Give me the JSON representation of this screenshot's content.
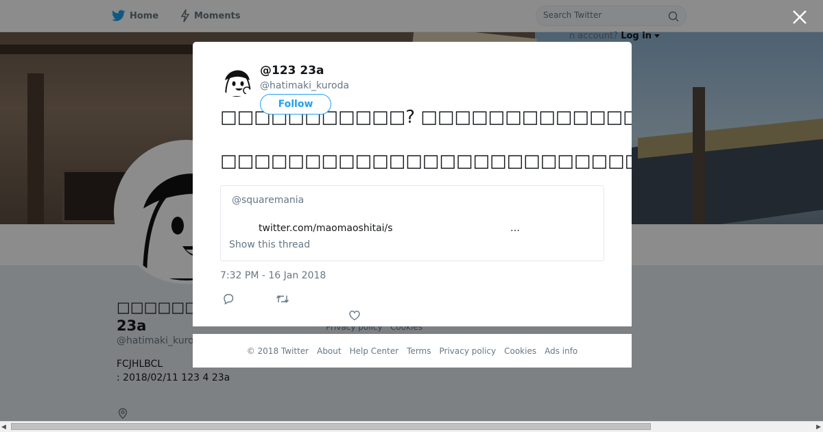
{
  "nav": {
    "home_label": "Home",
    "moments_label": "Moments",
    "search_placeholder": "Search Twitter",
    "login_prefix": "n account?",
    "login_label": "Log in"
  },
  "profile": {
    "name": "□□□□□□□@□ 23a",
    "handle": "@hatimaki_kuro",
    "bio": "FCJHLBCL\n      : 2018/02/11 123 4 23a",
    "footer_links": [
      "Privacy policy",
      "Cookies"
    ]
  },
  "modal": {
    "display_name": "@123 23a",
    "handle": "@hatimaki_kuroda",
    "follow_label": "Follow",
    "tweet_line1": "□□□□□□□□□□□? □□□□□□□□□□□□□□□□□□□□□□□□□□□□□□□□□□□□□□□□□",
    "tweet_line2": "□□□□□□□□□□□□□□□□□□□□□□□□□□□□□□□□□□□□□□□□□□□□□□□□□□□□□□□",
    "quote_handle": "@squaremania",
    "quote_link": "twitter.com/maomaoshitai/s",
    "quote_ellipsis": "…",
    "show_thread": "Show this thread",
    "timestamp": "7:32 PM - 16 Jan 2018"
  },
  "footer": {
    "copyright": "© 2018 Twitter",
    "about": "About",
    "help": "Help Center",
    "terms": "Terms",
    "privacy": "Privacy policy",
    "cookies": "Cookies",
    "ads": "Ads info"
  },
  "colors": {
    "brand": "#1da1f2",
    "secondary_text": "#657786",
    "overlay": "rgba(0,0,0,0.45)"
  },
  "icons": [
    "twitter-bird-icon",
    "lightning-icon",
    "search-icon",
    "close-icon",
    "reply-icon",
    "retweet-icon",
    "heart-icon",
    "location-pin-icon",
    "caret-down-icon"
  ]
}
